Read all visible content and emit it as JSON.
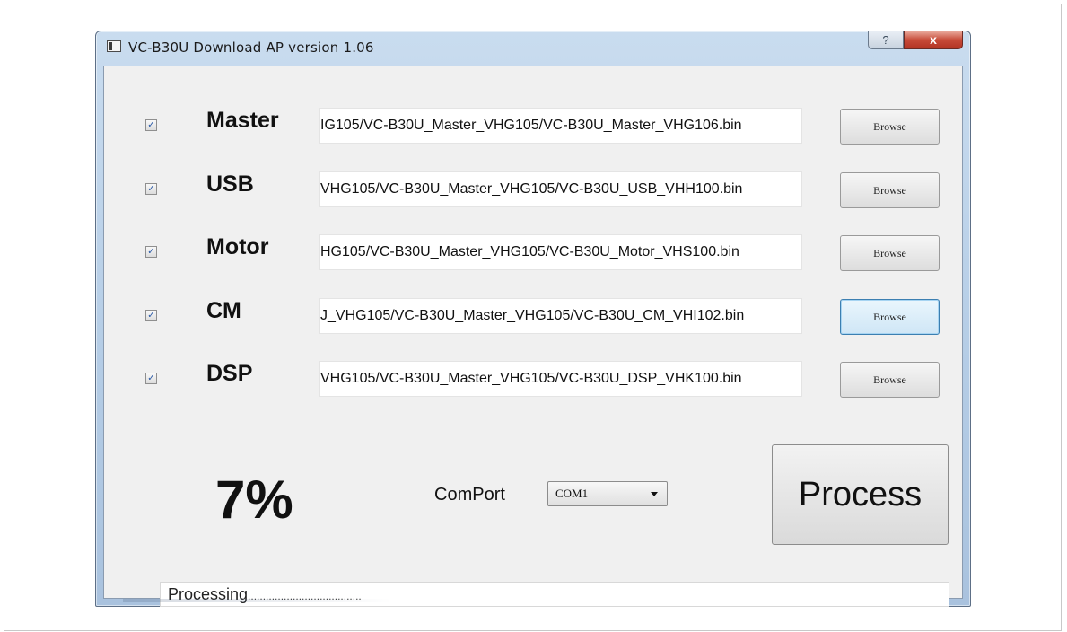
{
  "window": {
    "title": "VC-B30U Download AP version 1.06",
    "help_label": "?",
    "close_label": "x"
  },
  "rows": [
    {
      "label": "Master",
      "checked": true,
      "path": "IG105/VC-B30U_Master_VHG105/VC-B30U_Master_VHG106.bin",
      "browse_label": "Browse"
    },
    {
      "label": "USB",
      "checked": true,
      "path": "VHG105/VC-B30U_Master_VHG105/VC-B30U_USB_VHH100.bin",
      "browse_label": "Browse"
    },
    {
      "label": "Motor",
      "checked": true,
      "path": "HG105/VC-B30U_Master_VHG105/VC-B30U_Motor_VHS100.bin",
      "browse_label": "Browse"
    },
    {
      "label": "CM",
      "checked": true,
      "path": "J_VHG105/VC-B30U_Master_VHG105/VC-B30U_CM_VHI102.bin",
      "browse_label": "Browse"
    },
    {
      "label": "DSP",
      "checked": true,
      "path": "VHG105/VC-B30U_Master_VHG105/VC-B30U_DSP_VHK100.bin",
      "browse_label": "Browse"
    }
  ],
  "progress": {
    "percent_text": "7%"
  },
  "comport": {
    "label": "ComPort",
    "selected": "COM1"
  },
  "process_button": {
    "label": "Process"
  },
  "status": {
    "text": "Processing",
    "dots": "......................................"
  },
  "checkmark_glyph": "✓"
}
